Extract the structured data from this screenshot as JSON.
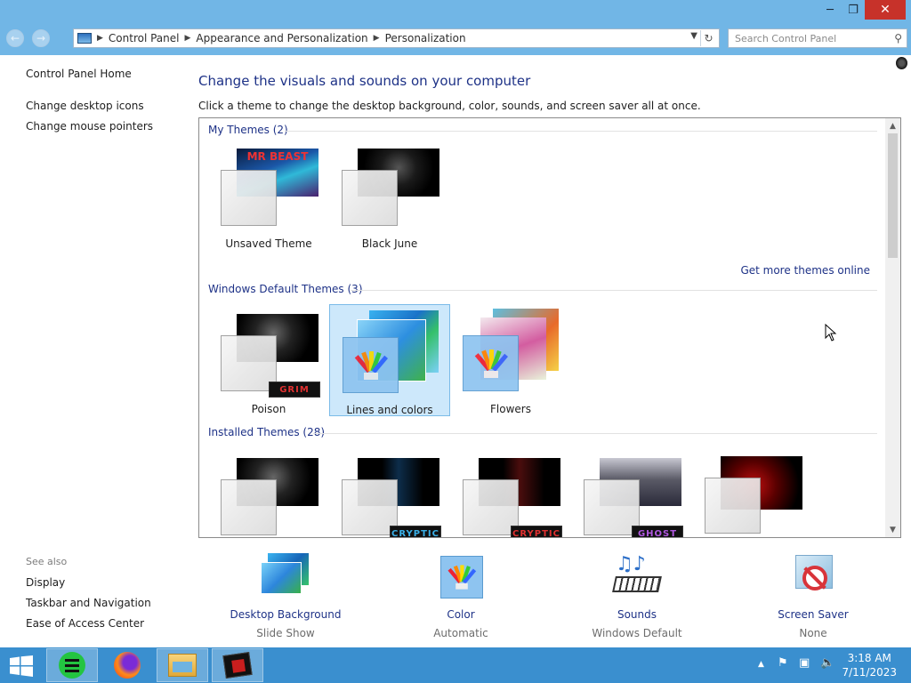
{
  "window": {
    "controls": {
      "minimize": "─",
      "maximize": "❐",
      "close": "✕"
    }
  },
  "address": {
    "breadcrumbs": [
      "Control Panel",
      "Appearance and Personalization",
      "Personalization"
    ],
    "search_placeholder": "Search Control Panel"
  },
  "sidebar": {
    "home": "Control Panel Home",
    "links": [
      "Change desktop icons",
      "Change mouse pointers"
    ],
    "see_also_label": "See also",
    "see_also": [
      "Display",
      "Taskbar and Navigation",
      "Ease of Access Center"
    ]
  },
  "main": {
    "title": "Change the visuals and sounds on your computer",
    "subtitle": "Click a theme to change the desktop background, color, sounds, and screen saver all at once.",
    "groups": {
      "my_themes": "My Themes (2)",
      "default_themes": "Windows Default Themes (3)",
      "installed_themes": "Installed Themes (28)"
    },
    "get_more": "Get more themes online",
    "my_themes": [
      {
        "label": "Unsaved Theme",
        "thumb_text": "MR BEAST"
      },
      {
        "label": "Black June"
      }
    ],
    "default_themes": [
      {
        "label": "Poison",
        "logo": "GRIM"
      },
      {
        "label": "Lines and colors",
        "selected": true
      },
      {
        "label": "Flowers"
      }
    ],
    "installed_themes": [
      {
        "logo": ""
      },
      {
        "logo": "CRYPTIC"
      },
      {
        "logo": "CRYPTIC"
      },
      {
        "logo": "GHOST"
      },
      {
        "logo": ""
      }
    ]
  },
  "settings": [
    {
      "name": "Desktop Background",
      "value": "Slide Show"
    },
    {
      "name": "Color",
      "value": "Automatic"
    },
    {
      "name": "Sounds",
      "value": "Windows Default"
    },
    {
      "name": "Screen Saver",
      "value": "None"
    }
  ],
  "taskbar": {
    "apps": [
      "notes-app",
      "firefox",
      "file-explorer",
      "personalization"
    ],
    "time": "3:18 AM",
    "date": "7/11/2023"
  },
  "colors": {
    "titlebar": "#71b6e6",
    "taskbar": "#3a8fcf",
    "link": "#1e3287",
    "selection": "#cde8fb"
  }
}
